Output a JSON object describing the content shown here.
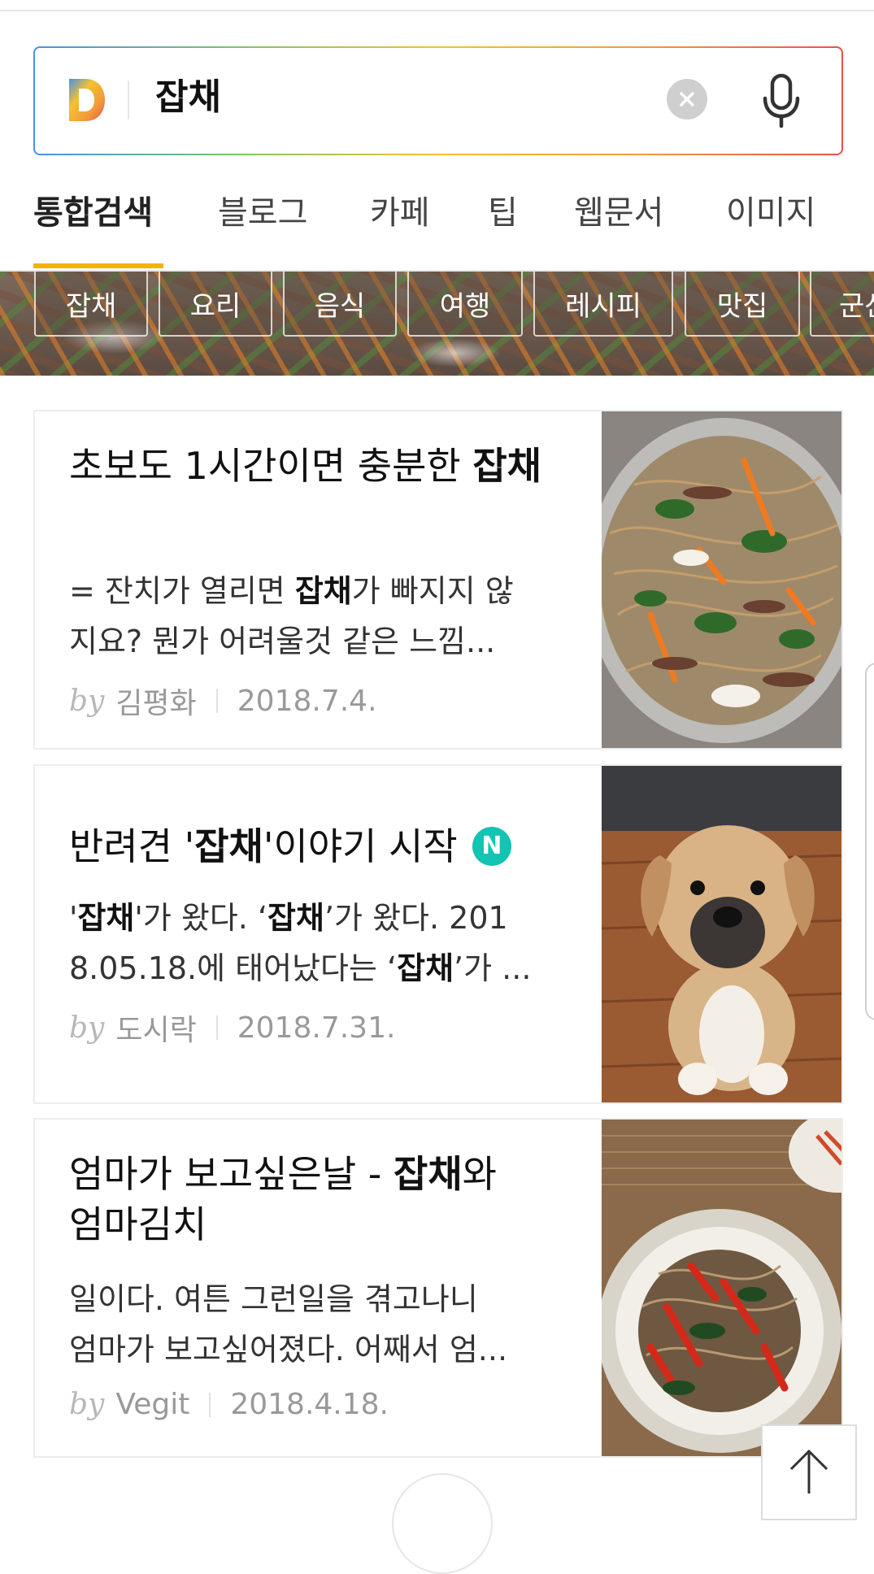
{
  "search": {
    "query": "잡채"
  },
  "tabs": [
    "통합검색",
    "블로그",
    "카페",
    "팁",
    "웹문서",
    "이미지"
  ],
  "chips": [
    "잡채",
    "요리",
    "음식",
    "여행",
    "레시피",
    "맛집",
    "군산"
  ],
  "results": [
    {
      "title_pre": "초보도 1시간이면 충분한 ",
      "title_bold": "잡채",
      "desc_line1_pre": "= 잔치가 열리면 ",
      "desc_line1_bold": "잡채",
      "desc_line1_post": "가 빠지지 않",
      "desc_line2": "지요? 뭔가 어려울것 같은 느낌...",
      "by": "by",
      "author": "김평화",
      "date": "2018.7.4."
    },
    {
      "title_pre": "반려견 '",
      "title_bold": "잡채",
      "title_post": "'이야기 시작",
      "badge": "N",
      "desc_line1_q1": "'",
      "desc_line1_b1": "잡채",
      "desc_line1_m1": "'가 왔다. ‘",
      "desc_line1_b2": "잡채",
      "desc_line1_m2": "’가 왔다. 201",
      "desc_line2_pre": "8.05.18.에 태어났다는 ‘",
      "desc_line2_bold": "잡채",
      "desc_line2_post": "’가 ...",
      "by": "by",
      "author": "도시락",
      "date": "2018.7.31."
    },
    {
      "title_pre": "엄마가 보고싶은날 - ",
      "title_bold": "잡채",
      "title_post": "와",
      "title_line2": "엄마김치",
      "desc_line1": "일이다. 여튼 그런일을 겪고나니",
      "desc_line2": "엄마가 보고싶어졌다. 어째서 엄...",
      "by": "by",
      "author": "Vegit",
      "date": "2018.4.18."
    }
  ]
}
